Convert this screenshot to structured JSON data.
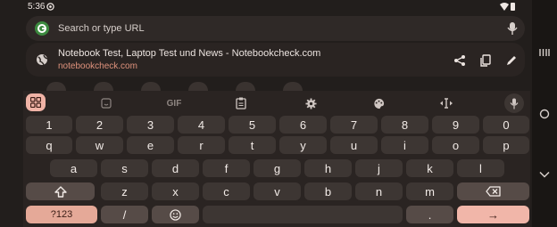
{
  "status": {
    "time": "5:36"
  },
  "omnibox": {
    "placeholder": "Search or type URL"
  },
  "suggestion": {
    "title": "Notebook Test, Laptop Test und News - Notebookcheck.com",
    "url": "notebookcheck.com"
  },
  "toolbar": {
    "gif": "GIF"
  },
  "keys": {
    "numbers": [
      "1",
      "2",
      "3",
      "4",
      "5",
      "6",
      "7",
      "8",
      "9",
      "0"
    ],
    "row1": [
      "q",
      "w",
      "e",
      "r",
      "t",
      "y",
      "u",
      "i",
      "o",
      "p"
    ],
    "row2": [
      "a",
      "s",
      "d",
      "f",
      "g",
      "h",
      "j",
      "k",
      "l"
    ],
    "row3": [
      "z",
      "x",
      "c",
      "v",
      "b",
      "n",
      "m"
    ],
    "symbols": "?123",
    "slash": "/",
    "period": ".",
    "enter": "→"
  },
  "colors": {
    "accent": "#f1b6a9",
    "url": "#e0937d"
  }
}
